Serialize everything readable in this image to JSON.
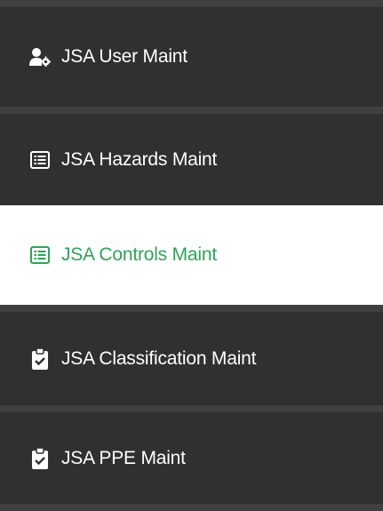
{
  "menu": {
    "items": [
      {
        "label": "JSA User Maint",
        "icon": "user-gear-icon",
        "active": false
      },
      {
        "label": "JSA Hazards Maint",
        "icon": "list-icon",
        "active": false
      },
      {
        "label": "JSA Controls Maint",
        "icon": "list-icon",
        "active": true
      },
      {
        "label": "JSA Classification Maint",
        "icon": "clipboard-check-icon",
        "active": false
      },
      {
        "label": "JSA PPE Maint",
        "icon": "clipboard-check-icon",
        "active": false
      }
    ]
  },
  "colors": {
    "item_bg": "#303030",
    "separator": "#3f3f3f",
    "active_bg": "#ffffff",
    "active_text": "#2ea35a",
    "text": "#ffffff"
  }
}
